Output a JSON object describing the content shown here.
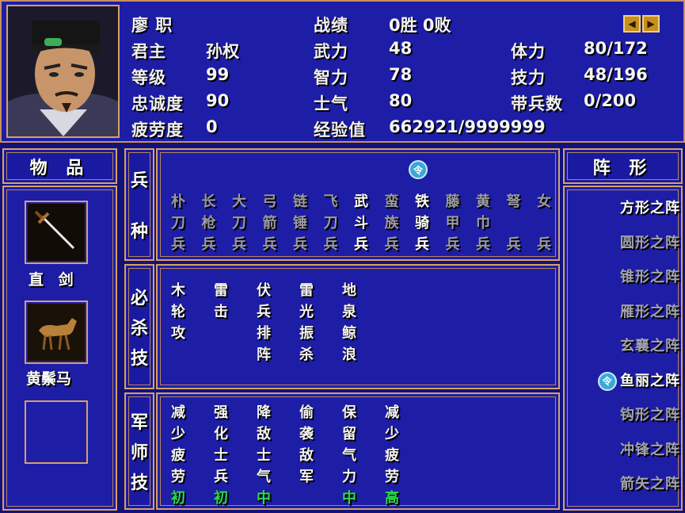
{
  "general": {
    "name": "廖  职",
    "labels": {
      "lord": "君主",
      "level": "等级",
      "loyalty": "忠诚度",
      "fatigue": "疲劳度",
      "record": "战绩",
      "force": "武力",
      "intel": "智力",
      "morale": "士气",
      "exp": "经验值",
      "hp": "体力",
      "skill": "技力",
      "troops": "带兵数"
    },
    "values": {
      "lord": "孙权",
      "level": "99",
      "loyalty": "90",
      "fatigue": "0",
      "record": "0胜 0败",
      "force": "48",
      "intel": "78",
      "morale": "80",
      "exp": "662921/9999999",
      "hp": "80/172",
      "skill": "48/196",
      "troops": "0/200"
    }
  },
  "items": {
    "title": "物 品",
    "list": [
      {
        "name": "直 剑",
        "icon": "sword-icon"
      },
      {
        "name": "黄鬃马",
        "icon": "horse-icon"
      },
      {
        "name": "",
        "icon": "empty-slot"
      }
    ]
  },
  "troops_section": {
    "label": [
      "兵",
      "种"
    ],
    "badge": "令",
    "columns": [
      {
        "chars": [
          "朴",
          "刀",
          "兵"
        ],
        "active": false
      },
      {
        "chars": [
          "长",
          "枪",
          "兵"
        ],
        "active": false
      },
      {
        "chars": [
          "大",
          "刀",
          "兵"
        ],
        "active": false
      },
      {
        "chars": [
          "弓",
          "箭",
          "兵"
        ],
        "active": false
      },
      {
        "chars": [
          "链",
          "锤",
          "兵"
        ],
        "active": false
      },
      {
        "chars": [
          "飞",
          "刀",
          "兵"
        ],
        "active": false
      },
      {
        "chars": [
          "武",
          "斗",
          "兵"
        ],
        "active": true
      },
      {
        "chars": [
          "蛮",
          "族",
          "兵"
        ],
        "active": false
      },
      {
        "chars": [
          "铁",
          "骑",
          "兵"
        ],
        "active": true
      },
      {
        "chars": [
          "藤",
          "甲",
          "兵"
        ],
        "active": false
      },
      {
        "chars": [
          "黄",
          "巾",
          "兵"
        ],
        "active": false
      },
      {
        "chars": [
          "弩",
          "",
          "兵"
        ],
        "active": false
      },
      {
        "chars": [
          "女",
          "",
          "兵"
        ],
        "active": false
      }
    ]
  },
  "special_section": {
    "label": [
      "必",
      "杀",
      "技"
    ],
    "columns": [
      {
        "chars": [
          "木",
          "轮",
          "攻",
          ""
        ]
      },
      {
        "chars": [
          "雷",
          "击",
          "",
          ""
        ]
      },
      {
        "chars": [
          "伏",
          "兵",
          "排",
          "阵"
        ]
      },
      {
        "chars": [
          "雷",
          "光",
          "振",
          "杀"
        ]
      },
      {
        "chars": [
          "地",
          "泉",
          "鲸",
          "浪"
        ]
      }
    ]
  },
  "strategist_section": {
    "label": [
      "军",
      "师",
      "技"
    ],
    "columns": [
      {
        "chars": [
          "减",
          "少",
          "疲",
          "劳"
        ],
        "level": "初"
      },
      {
        "chars": [
          "强",
          "化",
          "士",
          "兵"
        ],
        "level": "初"
      },
      {
        "chars": [
          "降",
          "敌",
          "士",
          "气"
        ],
        "level": "中"
      },
      {
        "chars": [
          "偷",
          "袭",
          "敌",
          "军"
        ],
        "level": ""
      },
      {
        "chars": [
          "保",
          "留",
          "气",
          "力"
        ],
        "level": "中"
      },
      {
        "chars": [
          "减",
          "少",
          "疲",
          "劳"
        ],
        "level": "高"
      }
    ]
  },
  "formations": {
    "title": "阵 形",
    "badge": "令",
    "list": [
      {
        "label": "方形之阵",
        "active": true
      },
      {
        "label": "圆形之阵",
        "active": false
      },
      {
        "label": "锥形之阵",
        "active": false
      },
      {
        "label": "雁形之阵",
        "active": false
      },
      {
        "label": "玄襄之阵",
        "active": false
      },
      {
        "label": "鱼丽之阵",
        "active": true,
        "selected": true
      },
      {
        "label": "钩形之阵",
        "active": false
      },
      {
        "label": "冲锋之阵",
        "active": false
      },
      {
        "label": "箭矢之阵",
        "active": false
      }
    ]
  },
  "colors": {
    "panel": "#1d1da6",
    "border": "#d6a06a",
    "green": "#2bd84a",
    "dim": "#9a9aa6"
  }
}
